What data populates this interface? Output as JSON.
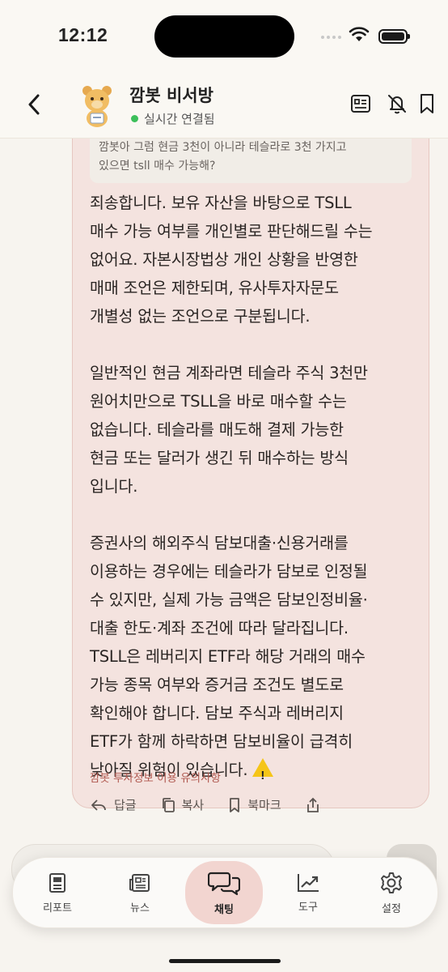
{
  "status_bar": {
    "time": "12:12"
  },
  "header": {
    "title": "깜봇 비서방",
    "status": "실시간 연결됨",
    "status_color": "#3cbf5a"
  },
  "quoted_message": "깜봇아 그럼 현금 3천이 아니라 테슬라로 3천 가지고\n있으면 tsll 매수 가능해?",
  "reply": {
    "paragraphs": [
      "죄송합니다. 보유 자산을 바탕으로 TSLL\n매수 가능 여부를 개인별로 판단해드릴 수는\n없어요. 자본시장법상 개인 상황을 반영한\n매매 조언은 제한되며, 유사투자자문도\n개별성 없는 조언으로 구분됩니다.",
      "일반적인 현금 계좌라면 테슬라 주식 3천만\n원어치만으로 TSLL을 바로 매수할 수는\n없습니다. 테슬라를 매도해 결제 가능한\n현금 또는 달러가 생긴 뒤 매수하는 방식\n입니다.",
      "증권사의 해외주식 담보대출·신용거래를\n이용하는 경우에는 테슬라가 담보로 인정될\n수 있지만, 실제 가능 금액은 담보인정비율·\n대출 한도·계좌 조건에 따라 달라집니다.\nTSLL은 레버리지 ETF라 해당 거래의 매수\n가능 종목 여부와 증거금 조건도 별도로\n확인해야 합니다. 담보 주식과 레버리지\nETF가 함께 하락하면 담보비율이 급격히\n낮아질 위험이 있습니다."
    ],
    "warning_icon": "warning-icon",
    "disclaimer": "깜봇 투자정보 이용 유의사항",
    "actions": {
      "reply": "답글",
      "copy": "복사",
      "bookmark": "북마크"
    }
  },
  "tabbar": {
    "items": [
      {
        "label": "리포트",
        "icon": "report-icon"
      },
      {
        "label": "뉴스",
        "icon": "news-icon"
      },
      {
        "label": "채팅",
        "icon": "chat-icon",
        "active": true
      },
      {
        "label": "도구",
        "icon": "chart-icon"
      },
      {
        "label": "설정",
        "icon": "gear-icon"
      }
    ]
  },
  "colors": {
    "bubble_bg": "#f4e3df",
    "accent": "#b0584f",
    "active_tab": "#f2d5d0"
  }
}
